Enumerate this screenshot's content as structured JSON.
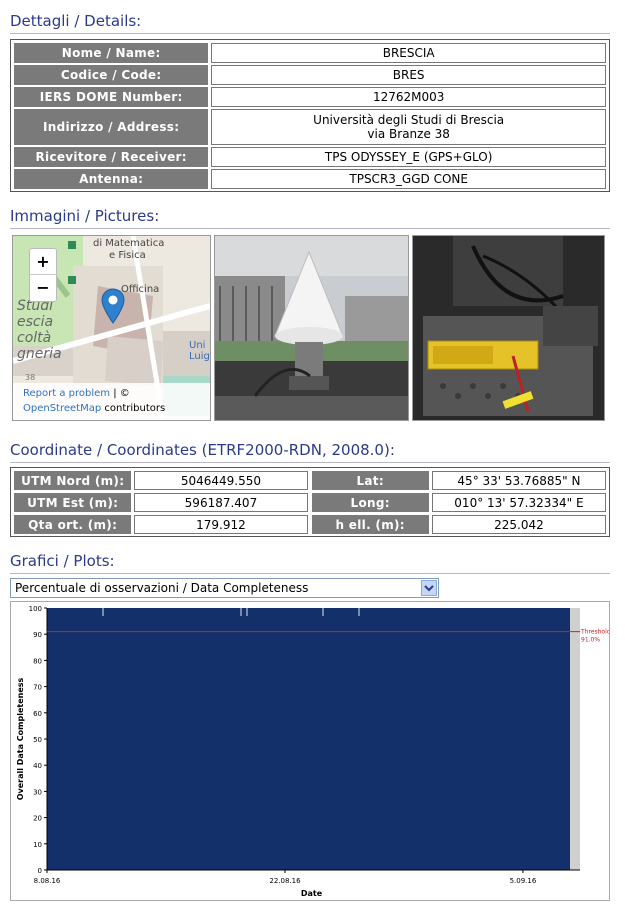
{
  "details": {
    "title": "Dettagli / Details:",
    "rows": [
      {
        "label": "Nome / Name:",
        "value": "BRESCIA"
      },
      {
        "label": "Codice / Code:",
        "value": "BRES"
      },
      {
        "label": "IERS DOME Number:",
        "value": "12762M003"
      },
      {
        "label": "Indirizzo / Address:",
        "value": "Università degli Studi di Brescia",
        "value2": "via Branze 38"
      },
      {
        "label": "Ricevitore / Receiver:",
        "value": "TPS ODYSSEY_E (GPS+GLO)"
      },
      {
        "label": "Antenna:",
        "value": "TPSCR3_GGD CONE"
      }
    ]
  },
  "pictures": {
    "title": "Immagini / Pictures:",
    "map": {
      "labels": [
        "di Matematica",
        "e Fisica",
        "Officina",
        "Studi",
        "escia",
        "coltà",
        "gneria",
        "Uni",
        "Luig",
        "38"
      ],
      "zoom_in": "+",
      "zoom_out": "−",
      "report": "Report a problem",
      "copyright": "| ©",
      "osm": "OpenStreetMap",
      "contributors": "contributors"
    }
  },
  "coordinates": {
    "title": "Coordinate / Coordinates (ETRF2000-RDN, 2008.0):",
    "rows": [
      {
        "l1": "UTM Nord (m):",
        "v1": "5046449.550",
        "l2": "Lat:",
        "v2": "45° 33' 53.76885\" N"
      },
      {
        "l1": "UTM Est (m):",
        "v1": "596187.407",
        "l2": "Long:",
        "v2": "010° 13' 57.32334\" E"
      },
      {
        "l1": "Qta ort. (m):",
        "v1": "179.912",
        "l2": "h ell. (m):",
        "v2": "225.042"
      }
    ]
  },
  "plots": {
    "title": "Grafici / Plots:",
    "select_value": "Percentuale di osservazioni / Data Completeness"
  },
  "chart_data": {
    "type": "area",
    "title": "",
    "xlabel": "Date",
    "ylabel": "Overall Data Completeness",
    "ylim": [
      0,
      100
    ],
    "yticks": [
      0,
      10,
      20,
      30,
      40,
      50,
      60,
      70,
      80,
      90,
      100
    ],
    "xticks": [
      "8.08.16",
      "22.08.16",
      "5.09.16"
    ],
    "threshold": {
      "value": 91,
      "label": "Threshold",
      "label2": "91.0%"
    },
    "series": [
      {
        "values": [
          100
        ]
      }
    ],
    "colors": {
      "fill": "#13306a",
      "threshold": "#cc2222",
      "gap": "#cfcfcf"
    }
  }
}
